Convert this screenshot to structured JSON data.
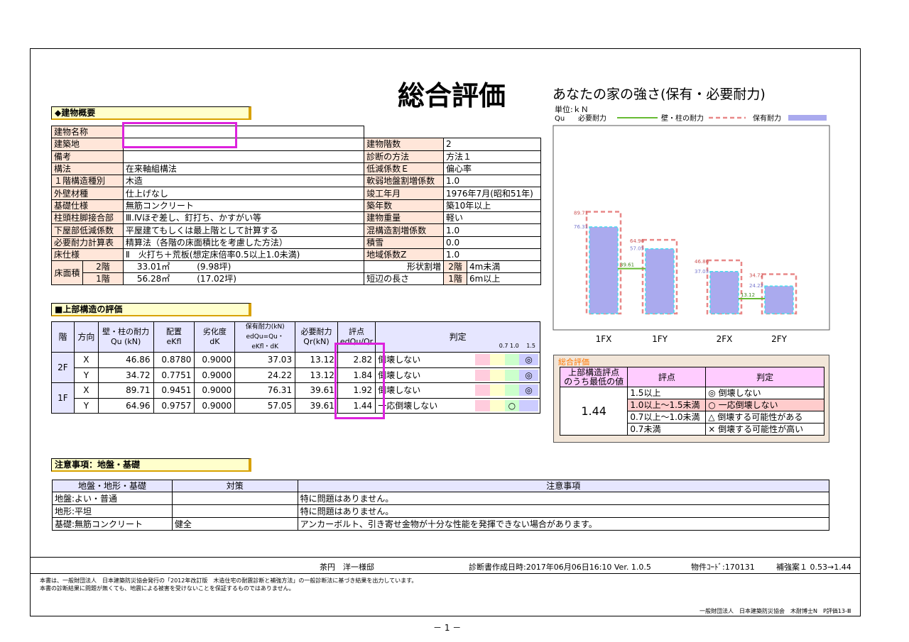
{
  "title": "総合評価",
  "building": {
    "section": "◆建物概要",
    "left": [
      {
        "label": "建物名称",
        "value": ""
      },
      {
        "label": "建築地",
        "value": ""
      },
      {
        "label": "備考",
        "value": ""
      },
      {
        "label": "構法",
        "value": "在来軸組構法"
      },
      {
        "label": "１階構造種別",
        "value": "木造"
      },
      {
        "label": "外壁材種",
        "value": "仕上げなし"
      },
      {
        "label": "基礎仕様",
        "value": "無筋コンクリート"
      },
      {
        "label": "柱頭柱脚接合部",
        "value": "Ⅲ.Ⅳほぞ差し、釘打ち、かすがい等"
      },
      {
        "label": "下屋部低減係数",
        "value": "平屋建てもしくは最上階として計算する"
      },
      {
        "label": "必要耐力計算表",
        "value": "精算法（各階の床面積比を考慮した方法）"
      },
      {
        "label": "床仕様",
        "value": "Ⅱ　火打ち＋荒板(想定床倍率0.5以上1.0未満)"
      }
    ],
    "right": [
      {
        "label": "建物階数",
        "value": "2"
      },
      {
        "label": "診断の方法",
        "value": "方法１"
      },
      {
        "label": "低減係数Ｅ",
        "value": "偏心率"
      },
      {
        "label": "軟弱地盤割増係数",
        "value": "1.0"
      },
      {
        "label": "竣工年月",
        "value": "1976年7月(昭和51年)"
      },
      {
        "label": "築年数",
        "value": "築10年以上"
      },
      {
        "label": "建物重量",
        "value": "軽い"
      },
      {
        "label": "混構造割増係数",
        "value": "1.0"
      },
      {
        "label": "積雪",
        "value": "0.0"
      },
      {
        "label": "地域係数Z",
        "value": "1.0"
      }
    ],
    "floor_area_label": "床面積",
    "floor2": {
      "floor": "2階",
      "m2": "33.01㎡",
      "tsubo": "(9.98坪)"
    },
    "floor1": {
      "floor": "1階",
      "m2": "56.28㎡",
      "tsubo": "(17.02坪)"
    },
    "shape_label": "形状割増",
    "shape_floor": "2階",
    "shape_value": "4m未満",
    "short_label": "短辺の長さ",
    "short_floor": "1階",
    "short_value": "6m以上"
  },
  "upper": {
    "section": "■上部構造の評価",
    "headers": {
      "floor": "階",
      "dir": "方向",
      "qu": "壁・柱の耐力\nQu (kN)",
      "ekfl": "配置\neKfl",
      "dk": "劣化度\ndK",
      "edqu": "保有耐力(kN)\nedQu=Qu・eKfl・dK",
      "qr": "必要耐力\nQr(kN)",
      "score": "評点\nedQu/Qr",
      "judge": "判定"
    },
    "scale_labels": "0.7 1.0 　1.5",
    "rows": [
      {
        "floor": "2F",
        "dir": "X",
        "qu": "46.86",
        "ekfl": "0.8780",
        "dk": "0.9000",
        "edqu": "37.03",
        "qr": "13.12",
        "score": "2.82",
        "judge": "倒壊しない",
        "mark": "◎",
        "level": 2.82
      },
      {
        "floor": "",
        "dir": "Y",
        "qu": "34.72",
        "ekfl": "0.7751",
        "dk": "0.9000",
        "edqu": "24.22",
        "qr": "13.12",
        "score": "1.84",
        "judge": "倒壊しない",
        "mark": "◎",
        "level": 1.84
      },
      {
        "floor": "1F",
        "dir": "X",
        "qu": "89.71",
        "ekfl": "0.9451",
        "dk": "0.9000",
        "edqu": "76.31",
        "qr": "39.61",
        "score": "1.92",
        "judge": "倒壊しない",
        "mark": "◎",
        "level": 1.92
      },
      {
        "floor": "",
        "dir": "Y",
        "qu": "64.96",
        "ekfl": "0.9757",
        "dk": "0.9000",
        "edqu": "57.05",
        "qr": "39.61",
        "score": "1.44",
        "judge": "一応倒壊しない",
        "mark": "○",
        "level": 1.44
      }
    ]
  },
  "summary": {
    "title": "総合評価",
    "h1": "上部構造評点\nのうち最低の値",
    "h2": "評点",
    "h3": "判定",
    "value": "1.44",
    "rows": [
      {
        "range": "1.5以上",
        "judge": "◎ 倒壊しない"
      },
      {
        "range": "1.0以上～1.5未満",
        "judge": "○ 一応倒壊しない"
      },
      {
        "range": "0.7以上～1.0未満",
        "judge": "△ 倒壊する可能性がある"
      },
      {
        "range": "0.7未満",
        "judge": "× 倒壊する可能性が高い"
      }
    ]
  },
  "notes": {
    "section": "注意事項：地盤・基礎",
    "headers": [
      "地盤・地形・基礎",
      "対策",
      "注意事項"
    ],
    "rows": [
      [
        "地盤:よい・普通",
        "",
        "特に問題はありません。"
      ],
      [
        "地形:平坦",
        "",
        "特に問題はありません。"
      ],
      [
        "基礎:無筋コンクリート",
        "健全",
        "アンカーボルト、引き寄せ金物が十分な性能を発揮できない場合があります。"
      ]
    ]
  },
  "footer": {
    "client": "茶円　洋一様邸",
    "date": "診断書作成日時:2017年06月06日16:10 Ver. 1.0.5",
    "code": "物件ｺｰﾄﾞ:170131",
    "reinforce": "補強案１ 0.53→1.44",
    "note1": "本書は、一般財団法人　日本建築防災協会発行の「2012年改訂版　木造住宅の耐震診断と補強方法」の一般診断法に基づき結果を出力しています。",
    "note2": "本書の診断結果に問題が無くても、地震による被害を受けないことを保証するものではありません。",
    "org": "一般財団法人　日本建築防災協会　木耐博士N　P評価13-Ⅲ",
    "page": "－ 1 －"
  },
  "chart_data": {
    "type": "bar",
    "title": "あなたの家の強さ(保有・必要耐力)",
    "unit": "単位:ｋＮ",
    "legend": {
      "qu_label": "Qu",
      "qr": "必要耐力",
      "qu": "壁・柱の耐力",
      "edqu": "保有耐力"
    },
    "categories": [
      "1FX",
      "1FY",
      "2FX",
      "2FY"
    ],
    "series": [
      {
        "name": "必要耐力",
        "values": [
          39.61,
          39.61,
          13.12,
          13.12
        ]
      },
      {
        "name": "壁・柱の耐力",
        "values": [
          89.71,
          64.96,
          46.86,
          34.72
        ]
      },
      {
        "name": "保有耐力",
        "values": [
          76.31,
          57.05,
          37.03,
          24.22
        ]
      }
    ],
    "labels": {
      "qu": [
        "89.71",
        "64.96",
        "46.86",
        "34.72"
      ],
      "edqu": [
        "76.31",
        "57.05",
        "37.03",
        "24.22"
      ],
      "qr": [
        "39.61",
        "13.12"
      ]
    },
    "ylim": [
      0,
      100
    ],
    "colors": {
      "qr": "#66bb33",
      "qu": "#e88888",
      "edqu": "#aaaaee",
      "edqu_border": "#44ddee"
    }
  }
}
